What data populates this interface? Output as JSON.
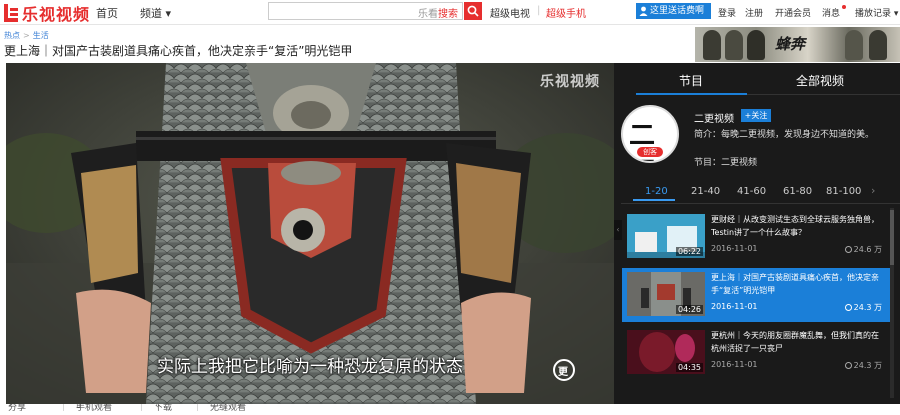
{
  "nav": {
    "logo_text": "乐视视频",
    "home": "首页",
    "channel": "频道 ▾",
    "search_value": "",
    "search_hint_prefix": "乐看",
    "search_hint_action": "搜索",
    "tv": "超级电视",
    "separator": "|",
    "phone": "超级手机",
    "user_button": "这里送话费啊",
    "login": "登录",
    "register": "注册",
    "vip": "开通会员",
    "messages": "消息",
    "history": "播放记录 ▾"
  },
  "breadcrumb": {
    "level1": "热点",
    "separator": ">",
    "level2": "生活"
  },
  "title": "更上海｜对国产古装剧道具痛心疾首，他决定亲手“复活”明光铠甲",
  "banner": {
    "text": "蜂奔"
  },
  "player": {
    "watermark": "乐视视频",
    "subtitle": "实际上我把它比喻为一种恐龙复原的状态",
    "badge": "更"
  },
  "sidebar": {
    "tabs": [
      "节目",
      "全部视频"
    ],
    "active_tab": 0,
    "channel": {
      "avatar_glyph": "二更",
      "avatar_badge": "创客",
      "name": "二更视频",
      "follow": "+关注",
      "intro": "简介：每晚二更视频，发现身边不知道的美。",
      "program": "节目：二更视频"
    },
    "pages": [
      "1-20",
      "21-40",
      "41-60",
      "61-80",
      "81-100"
    ],
    "active_page": 0,
    "next": "›",
    "items": [
      {
        "title": "更财经｜从改变测试生态到全球云服务独角兽，Testin讲了一个什么故事？",
        "date": "2016-11-01",
        "views": "24.6 万",
        "duration": "06:22",
        "thumb_color": "#3aa0c8"
      },
      {
        "title": "更上海｜对国产古装剧道具痛心疾首，他决定亲手“复活”明光铠甲",
        "date": "2016-11-01",
        "views": "24.3 万",
        "duration": "04:26",
        "thumb_color": "#6a6a66"
      },
      {
        "title": "更杭州｜今天的朋友圈群魔乱舞，但我们真的在杭州活捉了一只丧尸",
        "date": "2016-11-01",
        "views": "24.3 万",
        "duration": "04:35",
        "thumb_color": "#7a1a2a"
      }
    ]
  },
  "bottom": {
    "share": "分享",
    "mobile": "手机观看",
    "download": "下载",
    "report": "无缝观看"
  },
  "colors": {
    "brand": "#e62e2e",
    "accent": "#1b7fd8",
    "sidebar_bg": "#1a1a1a"
  }
}
